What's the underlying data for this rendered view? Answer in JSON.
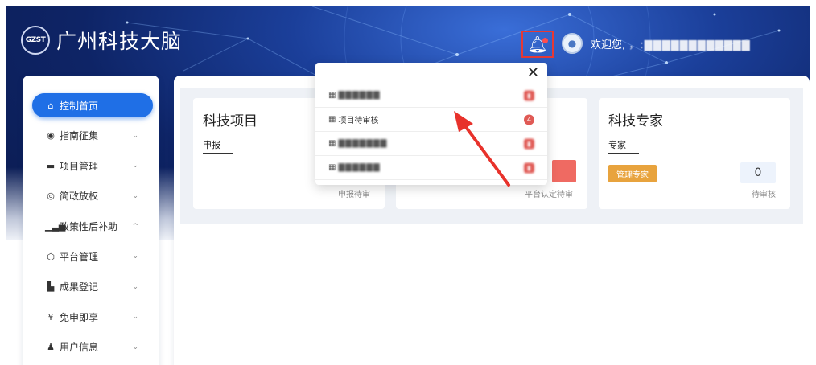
{
  "header": {
    "logo_mark": "GZST",
    "title": "广州科技大脑",
    "welcome_prefix": "欢迎您, ",
    "welcome_name": "，:▇▇▇▇▇▇▇▇▇▇▇▇"
  },
  "sidebar": {
    "items": [
      {
        "label": "控制首页",
        "icon": "home-icon",
        "glyph": "⌂",
        "chevron": ""
      },
      {
        "label": "指南征集",
        "icon": "globe-icon",
        "glyph": "◉",
        "chevron": "⌄"
      },
      {
        "label": "项目管理",
        "icon": "folder-icon",
        "glyph": "▬",
        "chevron": "⌄"
      },
      {
        "label": "简政放权",
        "icon": "circle-icon",
        "glyph": "◎",
        "chevron": "⌄"
      },
      {
        "label": "政策性后补助",
        "icon": "bar-chart-icon",
        "glyph": "▁▃▅",
        "chevron": "^"
      },
      {
        "label": "平台管理",
        "icon": "cube-icon",
        "glyph": "⬡",
        "chevron": "⌄"
      },
      {
        "label": "成果登记",
        "icon": "copy-icon",
        "glyph": "▙",
        "chevron": "⌄"
      },
      {
        "label": "免申即享",
        "icon": "yen-icon",
        "glyph": "¥",
        "chevron": "⌄"
      },
      {
        "label": "用户信息",
        "icon": "user-icon",
        "glyph": "♟",
        "chevron": "⌄"
      }
    ]
  },
  "cards": [
    {
      "title": "科技项目",
      "tab": "申报",
      "foot": "申报待审"
    },
    {
      "title": "",
      "tab": "",
      "foot": "平台认定待审"
    },
    {
      "title": "科技专家",
      "tab": "专家",
      "foot": "待审核",
      "button": "管理专家",
      "count": "0"
    }
  ],
  "notifications": {
    "close": "✕",
    "items": [
      {
        "label": "▇▇▇▇▇▇",
        "blurred": true,
        "badge": "▮"
      },
      {
        "label": "项目待审核",
        "blurred": false,
        "badge": "4"
      },
      {
        "label": "▇▇▇▇▇▇▇",
        "blurred": true,
        "badge": "▮"
      },
      {
        "label": "▇▇▇▇▇▇",
        "blurred": true,
        "badge": "▮"
      }
    ]
  },
  "colors": {
    "accent": "#1f6fe6",
    "badge_red": "#e05a55",
    "orange": "#e8a33d",
    "highlight_border": "#e53935",
    "arrow": "#e8322b"
  }
}
